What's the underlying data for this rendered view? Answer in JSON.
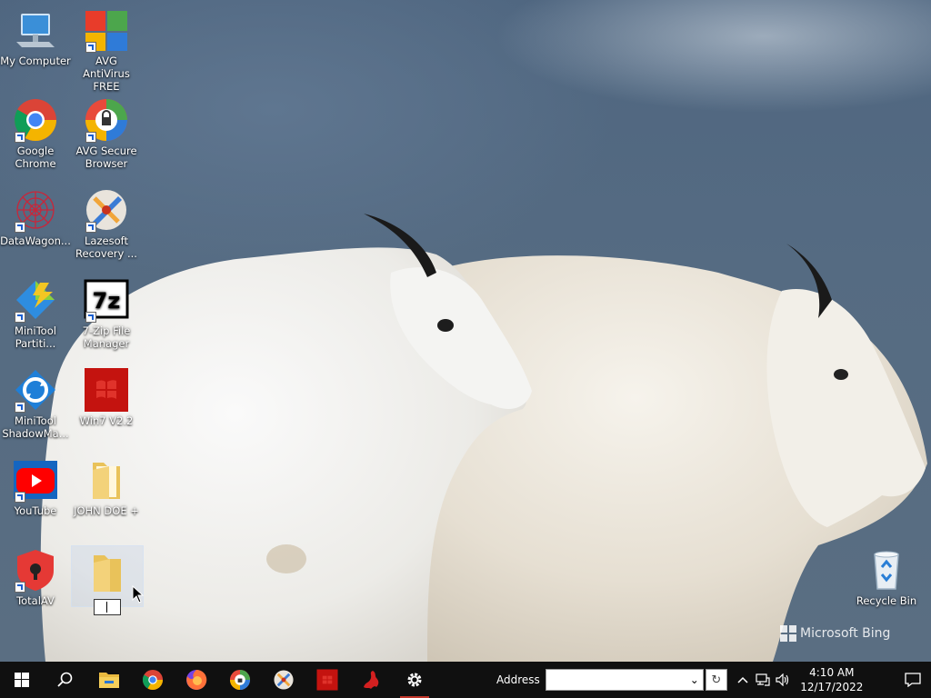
{
  "desktop": {
    "icons": [
      {
        "label": "My Computer",
        "icon": "computer-icon"
      },
      {
        "label": "AVG AntiVirus FREE",
        "icon": "avg-antivirus-icon"
      },
      {
        "label": "Google Chrome",
        "icon": "chrome-icon"
      },
      {
        "label": "AVG Secure Browser",
        "icon": "avg-browser-icon"
      },
      {
        "label": "DataWagon...",
        "icon": "datawagon-icon"
      },
      {
        "label": "Lazesoft Recovery ...",
        "icon": "lazesoft-icon"
      },
      {
        "label": "MiniTool Partiti...",
        "icon": "minitool-partition-icon"
      },
      {
        "label": "7-Zip File Manager",
        "icon": "7zip-icon"
      },
      {
        "label": "MiniTool ShadowMa...",
        "icon": "minitool-shadowmaker-icon"
      },
      {
        "label": "Win7 V2.2",
        "icon": "win7-icon"
      },
      {
        "label": "YouTube",
        "icon": "youtube-icon"
      },
      {
        "label": "JOHN DOE +",
        "icon": "folder-icon"
      },
      {
        "label": "TotalAV",
        "icon": "totalav-icon"
      },
      {
        "label": "",
        "icon": "folder-icon"
      },
      {
        "label": "Recycle Bin",
        "icon": "recycle-bin-icon"
      }
    ],
    "seven_zip_glyph": "7z",
    "bing_watermark": "Microsoft Bing"
  },
  "taskbar": {
    "address_label": "Address",
    "address_value": "",
    "address_dropdown_glyph": "⌄",
    "refresh_glyph": "↻",
    "clock_time": "4:10 AM",
    "clock_date": "12/17/2022"
  },
  "colors": {
    "taskbar": "#101010",
    "accent": "#76b9ed"
  }
}
